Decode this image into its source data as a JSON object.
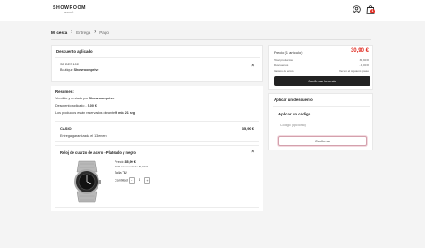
{
  "header": {
    "logo_main": "SHOWROOM",
    "logo_sub": "PRIVÉ",
    "cart_count": "1"
  },
  "breadcrumb": {
    "step1": "Mi cesta",
    "step2": "Entrega",
    "step3": "Pago"
  },
  "discount_panel": {
    "title": "Descuento aplicado",
    "code_line": "SE DES 10€",
    "shop_prefix": "Boutique",
    "shop_name": "Showroomprive"
  },
  "summary": {
    "title": "Resumen:",
    "sold_by_prefix": "Vendido y enviado por",
    "sold_by": "Showroomprive",
    "discount_prefix": "Descuento aplicado -",
    "discount_value": "5,00 €",
    "reserved_prefix": "Los productos están reservados durante",
    "reserved_time": "9 min 21 seg"
  },
  "brand_block": {
    "brand": "CASIO",
    "brand_price": "35,90 €",
    "delivery": "Entrega garantizada el 13 enero"
  },
  "product": {
    "name": "Reloj de cuarzo de acero - Plateado y negro",
    "price_label": "Precio",
    "price": "35,90 €",
    "rrp_label": "PVP recomendado",
    "rrp": "89,99 €",
    "size_label": "Talla",
    "size": "TU",
    "qty_label": "Cantidad",
    "qty_minus": "−",
    "qty_value": "1",
    "qty_plus": "+"
  },
  "order_summary": {
    "price_label": "Precio (1 artículo):",
    "price_value": "30,90 €",
    "row1_label": "Total productos",
    "row1_value": "35,90 €",
    "row2_label": "Descuentos",
    "row2_value": "- 5,00 €",
    "row3_label": "Gastos de envío",
    "row3_value": "Ver en el siguiente paso",
    "confirm_button": "Confirmar la cesta"
  },
  "apply_discount": {
    "title": "Aplicar un descuento",
    "subtitle": "Aplicar un código",
    "placeholder": "Código (opcional)",
    "confirm_button": "Confirmar"
  },
  "colors": {
    "accent_red": "#e0291f",
    "dark_button": "#222222",
    "outline_pink": "#d4a1ad"
  }
}
